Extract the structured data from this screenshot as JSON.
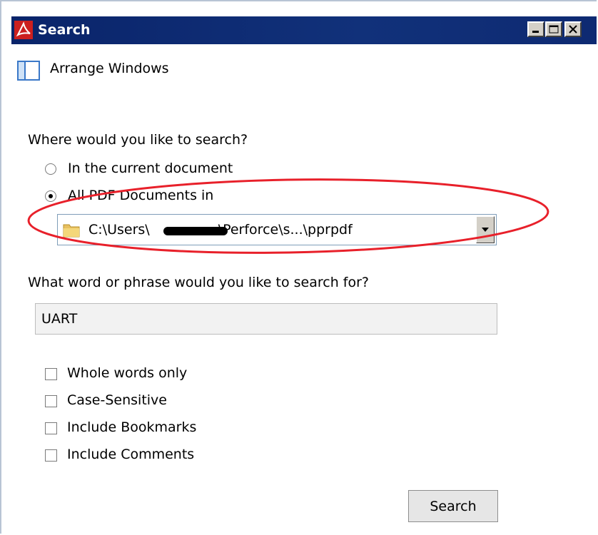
{
  "window": {
    "title": "Search"
  },
  "icons": {
    "app": "acrobat-icon",
    "minimize": "minimize-icon",
    "maximize": "maximize-icon",
    "close": "close-icon",
    "arrange": "arrange-windows-icon",
    "folder": "folder-icon",
    "dropdown": "chevron-down-icon"
  },
  "arrange": {
    "label": "Arrange Windows"
  },
  "where": {
    "question": "Where would you like to search?",
    "options": [
      {
        "label": "In the current document",
        "selected": false
      },
      {
        "label": "All PDF Documents in",
        "selected": true
      }
    ],
    "location": {
      "prefix": "C:\\Users\\",
      "suffix": "\\Perforce\\s...\\pprpdf"
    }
  },
  "what": {
    "question": "What word or phrase would you like to search for?",
    "value": "UART"
  },
  "options": [
    {
      "label": "Whole words only",
      "checked": false
    },
    {
      "label": "Case-Sensitive",
      "checked": false
    },
    {
      "label": "Include Bookmarks",
      "checked": false
    },
    {
      "label": "Include Comments",
      "checked": false
    }
  ],
  "actions": {
    "search_label": "Search"
  },
  "colors": {
    "titlebar": "#0a246a",
    "annotation": "#e8202a"
  }
}
